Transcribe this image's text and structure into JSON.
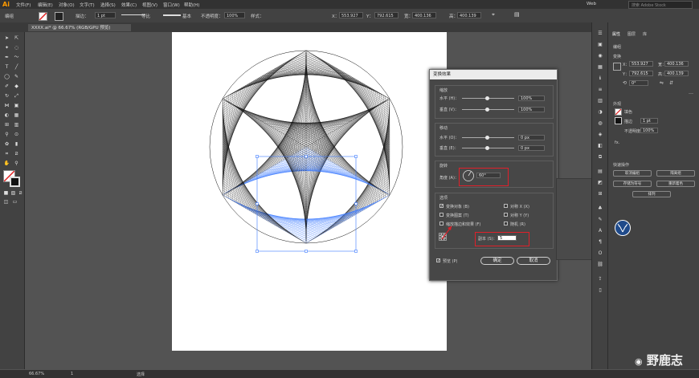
{
  "app": {
    "logo": "Ai"
  },
  "menubar": {
    "items": [
      "文件(F)",
      "编辑(E)",
      "对象(O)",
      "文字(T)",
      "选择(S)",
      "效果(C)",
      "视图(V)",
      "窗口(W)",
      "帮助(H)"
    ],
    "workspace": "Web",
    "search_placeholder": "搜索 Adobe Stock"
  },
  "controlbar": {
    "group_label": "编组",
    "stroke_label": "描边：",
    "stroke_value": "1 pt",
    "stroke_style": "等比",
    "brush_style": "基本",
    "opacity_label": "不透明度：",
    "opacity_value": "100%",
    "style_label": "样式：",
    "x_label": "X：",
    "x_value": "553.927",
    "y_label": "Y：",
    "y_value": "792.615",
    "w_label": "宽：",
    "w_value": "400.136",
    "h_label": "高：",
    "h_value": "400.139"
  },
  "document": {
    "tab_title": "XXXX.ai* @ 66.67% (RGB/GPU 预览)"
  },
  "dialog": {
    "title": "变换效果",
    "scale": {
      "header": "缩放",
      "h_label": "水平 (H)：",
      "h_value": "100%",
      "v_label": "垂直 (V)：",
      "v_value": "100%"
    },
    "move": {
      "header": "移动",
      "h_label": "水平 (O)：",
      "h_value": "0 px",
      "v_label": "垂直 (E)：",
      "v_value": "0 px"
    },
    "rotate": {
      "header": "旋转",
      "angle_label": "角度 (A)：",
      "angle_value": "60°"
    },
    "options": {
      "header": "选项",
      "transform_objects": "变换对象 (B)",
      "transform_patterns": "变换图案 (T)",
      "scale_strokes": "缩放描边和效果 (F)",
      "reflect_x": "对称 X (X)",
      "reflect_y": "对称 Y (Y)",
      "random": "随机 (R)",
      "copies_label": "副本 (S)：",
      "copies_value": "5"
    },
    "preview_label": "预览 (P)",
    "ok_label": "确定",
    "cancel_label": "取消"
  },
  "properties": {
    "tabs": [
      "属性",
      "图层",
      "库"
    ],
    "section_group": "编组",
    "section_transform": "变换",
    "x_label": "X：",
    "x_value": "553.927",
    "y_label": "Y：",
    "y_value": "792.615",
    "w_label": "宽：",
    "w_value": "400.136",
    "h_label": "高：",
    "h_value": "400.139",
    "angle_value": "0°",
    "section_appearance": "外观",
    "fill_label": "填色",
    "stroke_label": "描边",
    "stroke_value": "1 pt",
    "opacity_label": "不透明度",
    "opacity_value": "100%",
    "fx_label": "fx.",
    "section_quick": "快速操作",
    "quick_buttons": [
      "取消编组",
      "隔离组",
      "存储为符号",
      "重新着色",
      "排列"
    ]
  },
  "statusbar": {
    "zoom": "66.67%",
    "page": "1",
    "tool": "选择"
  },
  "watermark": {
    "text": "野鹿志"
  },
  "colors": {
    "accent": "#ff9a00",
    "selection": "#3d7bff",
    "highlight": "#e0202a"
  }
}
